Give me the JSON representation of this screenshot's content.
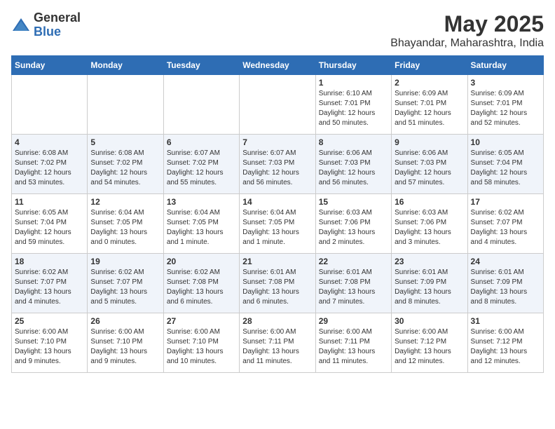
{
  "header": {
    "logo_general": "General",
    "logo_blue": "Blue",
    "month": "May 2025",
    "location": "Bhayandar, Maharashtra, India"
  },
  "weekdays": [
    "Sunday",
    "Monday",
    "Tuesday",
    "Wednesday",
    "Thursday",
    "Friday",
    "Saturday"
  ],
  "weeks": [
    [
      {
        "day": "",
        "info": ""
      },
      {
        "day": "",
        "info": ""
      },
      {
        "day": "",
        "info": ""
      },
      {
        "day": "",
        "info": ""
      },
      {
        "day": "1",
        "info": "Sunrise: 6:10 AM\nSunset: 7:01 PM\nDaylight: 12 hours\nand 50 minutes."
      },
      {
        "day": "2",
        "info": "Sunrise: 6:09 AM\nSunset: 7:01 PM\nDaylight: 12 hours\nand 51 minutes."
      },
      {
        "day": "3",
        "info": "Sunrise: 6:09 AM\nSunset: 7:01 PM\nDaylight: 12 hours\nand 52 minutes."
      }
    ],
    [
      {
        "day": "4",
        "info": "Sunrise: 6:08 AM\nSunset: 7:02 PM\nDaylight: 12 hours\nand 53 minutes."
      },
      {
        "day": "5",
        "info": "Sunrise: 6:08 AM\nSunset: 7:02 PM\nDaylight: 12 hours\nand 54 minutes."
      },
      {
        "day": "6",
        "info": "Sunrise: 6:07 AM\nSunset: 7:02 PM\nDaylight: 12 hours\nand 55 minutes."
      },
      {
        "day": "7",
        "info": "Sunrise: 6:07 AM\nSunset: 7:03 PM\nDaylight: 12 hours\nand 56 minutes."
      },
      {
        "day": "8",
        "info": "Sunrise: 6:06 AM\nSunset: 7:03 PM\nDaylight: 12 hours\nand 56 minutes."
      },
      {
        "day": "9",
        "info": "Sunrise: 6:06 AM\nSunset: 7:03 PM\nDaylight: 12 hours\nand 57 minutes."
      },
      {
        "day": "10",
        "info": "Sunrise: 6:05 AM\nSunset: 7:04 PM\nDaylight: 12 hours\nand 58 minutes."
      }
    ],
    [
      {
        "day": "11",
        "info": "Sunrise: 6:05 AM\nSunset: 7:04 PM\nDaylight: 12 hours\nand 59 minutes."
      },
      {
        "day": "12",
        "info": "Sunrise: 6:04 AM\nSunset: 7:05 PM\nDaylight: 13 hours\nand 0 minutes."
      },
      {
        "day": "13",
        "info": "Sunrise: 6:04 AM\nSunset: 7:05 PM\nDaylight: 13 hours\nand 1 minute."
      },
      {
        "day": "14",
        "info": "Sunrise: 6:04 AM\nSunset: 7:05 PM\nDaylight: 13 hours\nand 1 minute."
      },
      {
        "day": "15",
        "info": "Sunrise: 6:03 AM\nSunset: 7:06 PM\nDaylight: 13 hours\nand 2 minutes."
      },
      {
        "day": "16",
        "info": "Sunrise: 6:03 AM\nSunset: 7:06 PM\nDaylight: 13 hours\nand 3 minutes."
      },
      {
        "day": "17",
        "info": "Sunrise: 6:02 AM\nSunset: 7:07 PM\nDaylight: 13 hours\nand 4 minutes."
      }
    ],
    [
      {
        "day": "18",
        "info": "Sunrise: 6:02 AM\nSunset: 7:07 PM\nDaylight: 13 hours\nand 4 minutes."
      },
      {
        "day": "19",
        "info": "Sunrise: 6:02 AM\nSunset: 7:07 PM\nDaylight: 13 hours\nand 5 minutes."
      },
      {
        "day": "20",
        "info": "Sunrise: 6:02 AM\nSunset: 7:08 PM\nDaylight: 13 hours\nand 6 minutes."
      },
      {
        "day": "21",
        "info": "Sunrise: 6:01 AM\nSunset: 7:08 PM\nDaylight: 13 hours\nand 6 minutes."
      },
      {
        "day": "22",
        "info": "Sunrise: 6:01 AM\nSunset: 7:08 PM\nDaylight: 13 hours\nand 7 minutes."
      },
      {
        "day": "23",
        "info": "Sunrise: 6:01 AM\nSunset: 7:09 PM\nDaylight: 13 hours\nand 8 minutes."
      },
      {
        "day": "24",
        "info": "Sunrise: 6:01 AM\nSunset: 7:09 PM\nDaylight: 13 hours\nand 8 minutes."
      }
    ],
    [
      {
        "day": "25",
        "info": "Sunrise: 6:00 AM\nSunset: 7:10 PM\nDaylight: 13 hours\nand 9 minutes."
      },
      {
        "day": "26",
        "info": "Sunrise: 6:00 AM\nSunset: 7:10 PM\nDaylight: 13 hours\nand 9 minutes."
      },
      {
        "day": "27",
        "info": "Sunrise: 6:00 AM\nSunset: 7:10 PM\nDaylight: 13 hours\nand 10 minutes."
      },
      {
        "day": "28",
        "info": "Sunrise: 6:00 AM\nSunset: 7:11 PM\nDaylight: 13 hours\nand 11 minutes."
      },
      {
        "day": "29",
        "info": "Sunrise: 6:00 AM\nSunset: 7:11 PM\nDaylight: 13 hours\nand 11 minutes."
      },
      {
        "day": "30",
        "info": "Sunrise: 6:00 AM\nSunset: 7:12 PM\nDaylight: 13 hours\nand 12 minutes."
      },
      {
        "day": "31",
        "info": "Sunrise: 6:00 AM\nSunset: 7:12 PM\nDaylight: 13 hours\nand 12 minutes."
      }
    ]
  ]
}
